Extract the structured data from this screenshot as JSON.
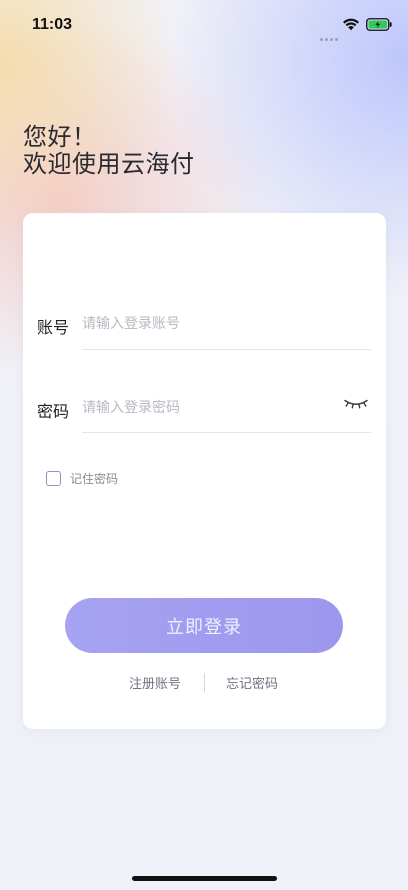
{
  "status_bar": {
    "time": "11:03"
  },
  "greeting": {
    "line1": "您好！",
    "line2": "欢迎使用云海付"
  },
  "login_form": {
    "account_label": "账号",
    "account_placeholder": "请输入登录账号",
    "account_value": "",
    "password_label": "密码",
    "password_placeholder": "请输入登录密码",
    "password_value": "",
    "password_visibility_icon": "eye-closed-icon",
    "remember_label": "记住密码",
    "remember_checked": false,
    "login_button": "立即登录",
    "register_link": "注册账号",
    "forgot_link": "忘记密码"
  },
  "colors": {
    "accent": "#9d96ee",
    "checkbox_border": "#8b93cc",
    "battery_fill": "#34c759"
  }
}
